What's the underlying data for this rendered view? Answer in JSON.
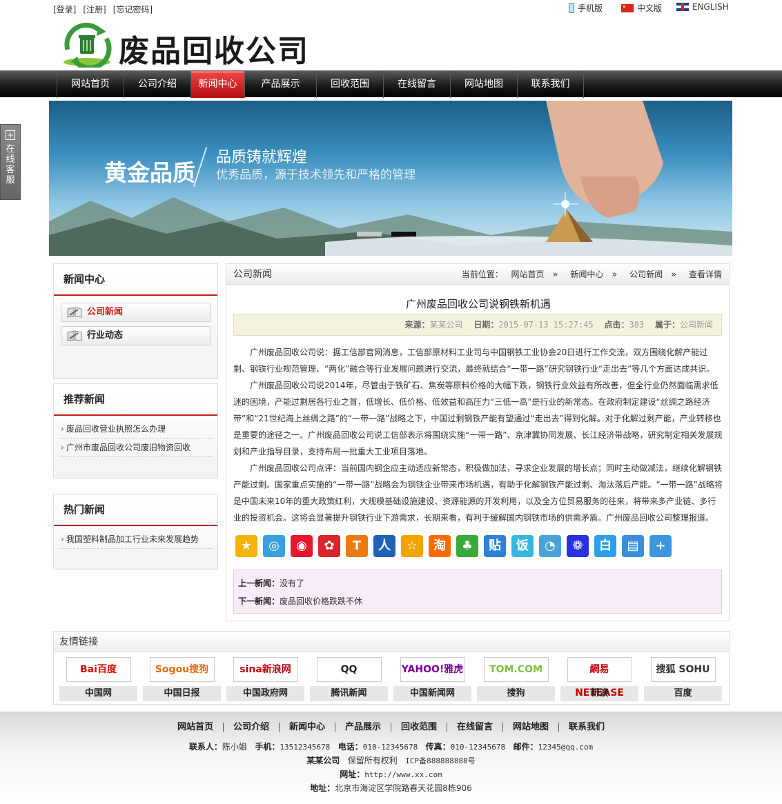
{
  "top": {
    "login": "[登录]",
    "register": "[注册]",
    "forgot": "[忘记密码]",
    "mobile": "手机版",
    "chinese": "中文版",
    "english": "ENGLISH"
  },
  "header": {
    "site_name": "废品回收公司"
  },
  "nav": [
    "网站首页",
    "公司介绍",
    "新闻中心",
    "产品展示",
    "回收范围",
    "在线留言",
    "网站地图",
    "联系我们"
  ],
  "banner": {
    "title": "黄金品质",
    "slogan": "品质铸就辉煌",
    "subslogan": "优秀品质，源于技术领先和严格的管理"
  },
  "service": {
    "label": "在线客服"
  },
  "sidebar": {
    "news_title": "新闻中心",
    "categories": [
      "公司新闻",
      "行业动态"
    ],
    "recommend_title": "推荐新闻",
    "recommend": [
      "废品回收营业执照怎么办理",
      "广州市废品回收公司废旧物资回收"
    ],
    "hot_title": "热门新闻",
    "hot": [
      "我国塑料制品加工行业未来发展趋势"
    ]
  },
  "main": {
    "section_title": "公司新闻",
    "crumb_label": "当前位置：",
    "crumbs": [
      "网站首页",
      "新闻中心",
      "公司新闻",
      "查看详情"
    ],
    "article_title": "广州废品回收公司说钢铁新机遇",
    "meta": {
      "source_label": "来源：",
      "source": "某某公司",
      "date_label": "日期：",
      "date": "2015-07-13 15:27:45",
      "hits_label": "点击：",
      "hits": "383",
      "belong_label": "属于：",
      "belong": "公司新闻"
    },
    "paragraphs": [
      "广州废品回收公司说：据工信部官网消息，工信部原材料工业司与中国钢铁工业协会20日进行工作交流，双方围绕化解产能过剩、钢铁行业规范管理、“两化”融合等行业发展问题进行交流，最终就结合“一带一路”研究钢铁行业“走出去”等几个方面达成共识。",
      "广州废品回收公司说2014年，尽管由于铁矿石、焦炭等原料价格的大幅下跌，钢铁行业效益有所改善，但全行业仍然面临需求低迷的困境，产能过剩居各行业之首，低增长、低价格、低效益和高压力“三低一高”是行业的新常态。在政府制定建设“丝绸之路经济带”和“21世纪海上丝绸之路”的“一带一路”战略之下，中国过剩钢铁产能有望通过“走出去”得到化解。对于化解过剩产能，产业转移也是重要的途径之一。广州废品回收公司说工信部表示将围绕实施“一带一路”、京津冀协同发展、长江经济带战略，研究制定相关发展规划和产业指导目录，支持布局一批重大工业项目落地。",
      "广州废品回收公司点评：当前国内钢企应主动适应新常态，积极做加法，寻求企业发展的增长点；同时主动做减法，继续化解钢铁产能过剩。国家重点实施的“一带一路”战略会为钢铁企业带来市场机遇，有助于化解钢铁产能过剩、淘汰落后产能。“一带一路”战略将是中国未来10年的重大政策红利，大规模基础设施建设、资源能源的开发利用，以及全方位贸易服务的往来，将带来多产业链、多行业的投资机会。这将会显著提升钢铁行业下游需求，长期来看，有利于缓解国内钢铁市场的供需矛盾。广州废品回收公司整理报道。"
    ],
    "share_icons": [
      {
        "name": "qzone-icon",
        "glyph": "★",
        "color": "#f5b400"
      },
      {
        "name": "qq-weibo-icon",
        "glyph": "◎",
        "color": "#3aa0e0"
      },
      {
        "name": "sina-weibo-icon",
        "glyph": "◉",
        "color": "#e6162d"
      },
      {
        "name": "netease-weibo-icon",
        "glyph": "✿",
        "color": "#d9262c"
      },
      {
        "name": "tianya-icon",
        "glyph": "T",
        "color": "#e97b12"
      },
      {
        "name": "people-icon",
        "glyph": "人",
        "color": "#1e63b6"
      },
      {
        "name": "pengyou-icon",
        "glyph": "☆",
        "color": "#f4a400"
      },
      {
        "name": "taobao-icon",
        "glyph": "淘",
        "color": "#ff6a00"
      },
      {
        "name": "kaixin-icon",
        "glyph": "♣",
        "color": "#3aa83a"
      },
      {
        "name": "tieba-icon",
        "glyph": "贴",
        "color": "#2f80d8"
      },
      {
        "name": "fanfou-icon",
        "glyph": "饭",
        "color": "#38b6e0"
      },
      {
        "name": "sohu-icon",
        "glyph": "◔",
        "color": "#4aa3d8"
      },
      {
        "name": "baidu-icon",
        "glyph": "❁",
        "color": "#2932e1"
      },
      {
        "name": "baidu-bai-icon",
        "glyph": "白",
        "color": "#2e9ee8"
      },
      {
        "name": "print-icon",
        "glyph": "▤",
        "color": "#3b8fd9"
      },
      {
        "name": "more-icon",
        "glyph": "+",
        "color": "#3a97e0"
      }
    ],
    "prev_label": "上一新闻：",
    "prev": "没有了",
    "next_label": "下一新闻：",
    "next": "废品回收价格跌跌不休"
  },
  "links": {
    "title": "友情链接",
    "items": [
      {
        "logo": "Bai百度",
        "logo_color": "#e10601",
        "name": "中国网"
      },
      {
        "logo": "Sogou搜狗",
        "logo_color": "#e96b0e",
        "name": "中国日报"
      },
      {
        "logo": "sina新浪网",
        "logo_color": "#c2000b",
        "name": "中国政府网"
      },
      {
        "logo": "QQ",
        "logo_color": "#222222",
        "name": "腾讯新闻"
      },
      {
        "logo": "YAHOO!雅虎",
        "logo_color": "#7b0099",
        "name": "中国新闻网"
      },
      {
        "logo": "TOM.COM",
        "logo_color": "#7cc142",
        "name": "搜狗"
      },
      {
        "logo": "網易 NETEASE",
        "logo_color": "#c40000",
        "name": "新浪"
      },
      {
        "logo": "搜狐 SOHU",
        "logo_color": "#333333",
        "name": "百度"
      }
    ]
  },
  "footer": {
    "nav": [
      "网站首页",
      "公司介绍",
      "新闻中心",
      "产品展示",
      "回收范围",
      "在线留言",
      "网站地图",
      "联系我们"
    ],
    "contact_label": "联系人：",
    "contact": "陈小姐",
    "mobile_label": "手机：",
    "mobile": "13512345678",
    "phone_label": "电话：",
    "phone": "010-12345678",
    "fax_label": "传真：",
    "fax": "010-12345678",
    "email_label": "邮件：",
    "email": "12345@qq.com",
    "company": "某某公司",
    "copyright": "保留所有权利",
    "icp": "ICP备888888888号",
    "url_label": "网址：",
    "url": "http://www.xx.com",
    "address_label": "地址：",
    "address": "北京市海淀区学院路春天花园8栋906"
  }
}
